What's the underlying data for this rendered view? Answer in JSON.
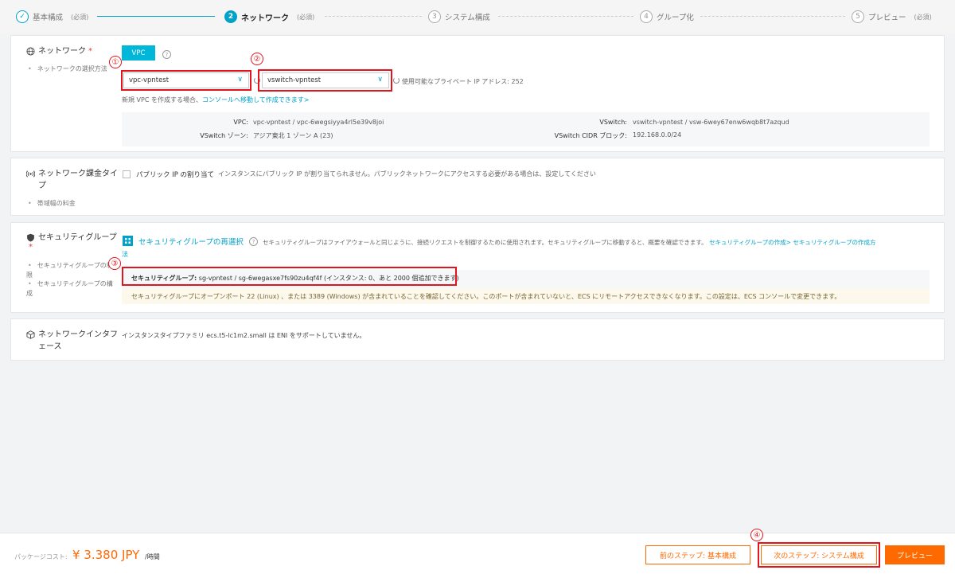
{
  "stepper": {
    "steps": [
      {
        "number": "✓",
        "label": "基本構成",
        "req": "(必須)"
      },
      {
        "number": "2",
        "label": "ネットワーク",
        "req": "(必須)"
      },
      {
        "number": "3",
        "label": "システム構成",
        "req": ""
      },
      {
        "number": "4",
        "label": "グループ化",
        "req": ""
      },
      {
        "number": "5",
        "label": "プレビュー",
        "req": "(必須)"
      }
    ]
  },
  "network": {
    "title": "ネットワーク",
    "required_mark": "*",
    "sub": "ネットワークの選択方法",
    "vpc_button": "VPC",
    "help": "?",
    "vpc_select": "vpc-vpntest",
    "vswitch_select": "vswitch-vpntest",
    "available_ip": "使用可能なプライベート IP アドレス: 252",
    "create_vpc_text": "新規 VPC を作成する場合、",
    "create_vpc_link": "コンソールへ移動して作成できます>",
    "info": {
      "vpc_key": "VPC:",
      "vpc_val": "vpc-vpntest / vpc-6wegsiyya4rl5e39v8joi",
      "zone_key": "VSwitch ゾーン:",
      "zone_val": "アジア東北 1 ゾーン A (23)",
      "vswitch_key": "VSwitch:",
      "vswitch_val": "vswitch-vpntest / vsw-6wey67enw6wqb8t7azqud",
      "cidr_key": "VSwitch CIDR ブロック:",
      "cidr_val": "192.168.0.0/24"
    }
  },
  "billing": {
    "title": "ネットワーク課金タイプ",
    "sub": "帯域幅の料金",
    "public_ip_label": "パブリック IP の割り当て",
    "public_ip_desc": "インスタンスにパブリック IP が割り当てられません。パブリックネットワークにアクセスする必要がある場合は、設定してください"
  },
  "security": {
    "title": "セキュリティグループ",
    "required_mark": "*",
    "sub1": "セキュリティグループの制限",
    "sub2": "セキュリティグループの構成",
    "reselect": "セキュリティグループの再選択",
    "desc": "セキュリティグループはファイアウォールと同じように、接続リクエストを制御するために使用されます。セキュリティグループに移動すると、概要を確認できます。",
    "create_link": "セキュリティグループの作成>",
    "create_link2_a": "セキュリティグループの作成方",
    "create_link2_b": "法",
    "sg_label": "セキュリティグループ:",
    "sg_value": "sg-vpntest / sg-6wegasxe7fs90zu4qf4f (インスタンス: 0、あと 2000 個追加できます)",
    "warning": "セキュリティグループにオープンポート 22 (Linux) 、または 3389 (Windows) が含まれていることを確認してください。このポートが含まれていないと、ECS にリモートアクセスできなくなります。この設定は、ECS コンソールで変更できます。"
  },
  "eni": {
    "title": "ネットワークインタフェース",
    "desc": "インスタンスタイプファミリ ecs.t5-lc1m2.small は ENI をサポートしていません。"
  },
  "markers": [
    "①",
    "②",
    "③",
    "④"
  ],
  "footer": {
    "cost_label": "パッケージコスト:",
    "cost_value": "¥ 3.380 JPY",
    "cost_unit": "/時間",
    "prev_button": "前のステップ: 基本構成",
    "next_button": "次のステップ: システム構成",
    "preview_button": "プレビュー"
  },
  "colors": {
    "accent": "#00a2ca",
    "orange": "#ff6a00",
    "annotation_red": "#e3141c"
  }
}
